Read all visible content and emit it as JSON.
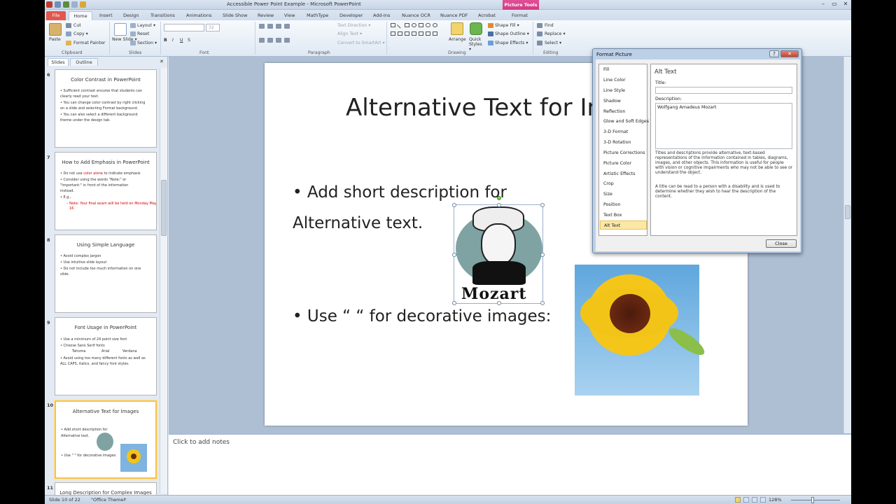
{
  "window": {
    "title": "Accessible Power Point Example - Microsoft PowerPoint",
    "contextual_group": "Picture Tools",
    "controls": [
      "–",
      "▭",
      "✕"
    ]
  },
  "ribbon_tabs": [
    "File",
    "Home",
    "Insert",
    "Design",
    "Transitions",
    "Animations",
    "Slide Show",
    "Review",
    "View",
    "MathType",
    "Developer",
    "Add-Ins",
    "Nuance OCR",
    "Nuance PDF",
    "Acrobat",
    "Format"
  ],
  "ribbon": {
    "clipboard": {
      "label": "Clipboard",
      "paste": "Paste",
      "cut": "Cut",
      "copy": "Copy ▾",
      "format_painter": "Format Painter"
    },
    "slides": {
      "label": "Slides",
      "new_slide": "New Slide ▾",
      "layout": "Layout ▾",
      "reset": "Reset",
      "section": "Section ▾"
    },
    "font": {
      "label": "Font",
      "size": "32"
    },
    "paragraph": {
      "label": "Paragraph",
      "text_direction": "Text Direction ▾",
      "align_text": "Align Text ▾",
      "convert": "Convert to SmartArt ▾"
    },
    "drawing": {
      "label": "Drawing",
      "arrange": "Arrange",
      "quick_styles": "Quick Styles ▾",
      "shape_fill": "Shape Fill ▾",
      "shape_outline": "Shape Outline ▾",
      "shape_effects": "Shape Effects ▾"
    },
    "editing": {
      "label": "Editing",
      "find": "Find",
      "replace": "Replace ▾",
      "select": "Select ▾"
    }
  },
  "panel": {
    "tabs": [
      "Slides",
      "Outline"
    ],
    "close": "✕",
    "slides": [
      {
        "num": "6",
        "title": "Color Contrast in PowerPoint",
        "bullets": [
          "• Sufficient contrast ensures that students can",
          "   clearly read your text.",
          "• You can change color contrast by right clicking",
          "   on a slide and selecting Format background.",
          "• You can also select a different background",
          "   theme under the design tab."
        ]
      },
      {
        "num": "7",
        "title": "How to Add Emphasis in PowerPoint",
        "b1_pre": "• Do not use ",
        "b1_red": "color alone",
        "b1_post": " to indicate emphasis",
        "bullets": [
          "• Consider using the words \"Note:\" or",
          "   \"Important:\" in front of the information",
          "   instead.",
          "• E.g.,"
        ],
        "red_note": "– Note: Your final exam will be held on Monday May",
        "red_note2": "16"
      },
      {
        "num": "8",
        "title": "Using Simple Language",
        "bullets": [
          "• Avoid complex jargon",
          "• Use intuitive slide layout",
          "• Do not include too much information on one",
          "   slide."
        ]
      },
      {
        "num": "9",
        "title": "Font Usage in PowerPoint",
        "bullets": [
          "• Use a minimum of 24 point size font",
          "• Choose Sans Serif fonts"
        ],
        "fonts": [
          "Tahoma",
          "Arial",
          "Verdana"
        ],
        "bullets2": [
          "• Avoid using too many different fonts as well as",
          "   ALL CAPS, italics, and fancy font styles."
        ]
      },
      {
        "num": "10",
        "title": "Alternative Text for Images",
        "bullets": [
          "• Add short description for",
          "   Alternative text.",
          "• Use \" \" for decorative images:"
        ]
      },
      {
        "num": "11",
        "title": "Long Description for Complex Images"
      }
    ]
  },
  "slide": {
    "title": "Alternative Text for Images",
    "bullet1_line1": "• Add short description for",
    "bullet1_line2": "Alternative text.",
    "bullet2": "• Use “ “ for decorative images:",
    "mozart_caption": "Mozart"
  },
  "notes": {
    "placeholder": "Click to add notes"
  },
  "status": {
    "slide": "Slide 10 of 22",
    "theme": "\"Office Theme\"",
    "zoom": "128%"
  },
  "dialog": {
    "title": "Format Picture",
    "help": "?",
    "close_x": "✕",
    "categories": [
      "Fill",
      "Line Color",
      "Line Style",
      "Shadow",
      "Reflection",
      "Glow and Soft Edges",
      "3-D Format",
      "3-D Rotation",
      "Picture Corrections",
      "Picture Color",
      "Artistic Effects",
      "Crop",
      "Size",
      "Position",
      "Text Box",
      "Alt Text"
    ],
    "selected_category": "Alt Text",
    "heading": "Alt Text",
    "title_label": "Title:",
    "title_value": "",
    "description_label": "Description:",
    "description_value": "Wolfgang Amadeus Mozart",
    "help_text_1": "Titles and descriptions provide alternative, text-based representations of the information contained in tables, diagrams, images, and other objects. This information is useful for people with vision or cognitive impairments who may not be able to see or understand the object.",
    "help_text_2": "A title can be read to a person with a disability and is used to determine whether they wish to hear the description of the content.",
    "close_button": "Close"
  },
  "colors": {
    "file_tab": "#e3564b",
    "picture_tools": "#d23a84",
    "selection": "#f6c24b",
    "slide_bg": "#ffffff",
    "editor_bg": "#aebfd4"
  }
}
